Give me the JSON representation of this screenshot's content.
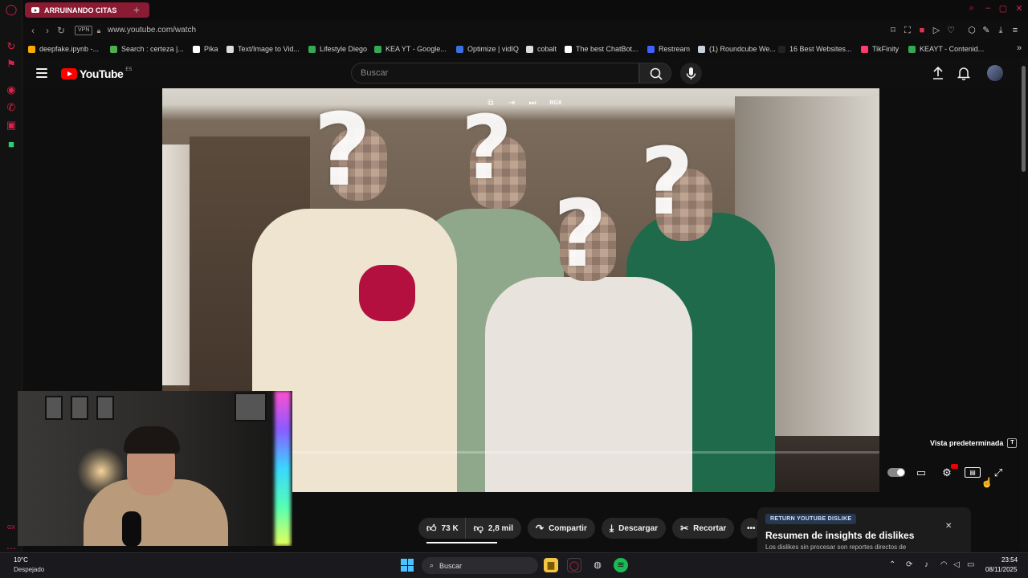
{
  "browser": {
    "tab_title": "ARRUINANDO CITAS",
    "vpn_label": "VPN",
    "url": "www.youtube.com/watch",
    "bookmarks": [
      {
        "label": "deepfake.ipynb -...",
        "color": "#f9ab00"
      },
      {
        "label": "Search : certeza |...",
        "color": "#4caf50"
      },
      {
        "label": "Pika",
        "color": "#ffffff"
      },
      {
        "label": "Text/Image to Vid...",
        "color": "#dddddd"
      },
      {
        "label": "Lifestyle Diego",
        "color": "#34a853"
      },
      {
        "label": "KEA YT - Google...",
        "color": "#34a853"
      },
      {
        "label": "Optimize | vidIQ",
        "color": "#3d6fe0"
      },
      {
        "label": "cobalt",
        "color": "#dddddd"
      },
      {
        "label": "The best ChatBot...",
        "color": "#ffffff"
      },
      {
        "label": "Restream",
        "color": "#3f61ff"
      },
      {
        "label": "(1) Roundcube We...",
        "color": "#c5d3e0"
      },
      {
        "label": "16 Best Websites...",
        "color": "#222222"
      },
      {
        "label": "TikFinity",
        "color": "#ff3b6b"
      },
      {
        "label": "KEAYT - Contenid...",
        "color": "#34a853"
      }
    ]
  },
  "youtube": {
    "logo_text": "YouTube",
    "region": "ES",
    "search_placeholder": "Buscar"
  },
  "player": {
    "overlay_tool_rgx": "RGX",
    "view_label": "Vista predeterminada",
    "view_key": "T",
    "blur_marks": [
      "?",
      "?",
      "?",
      "?"
    ]
  },
  "actions": {
    "likes": "73 K",
    "dislikes": "2,8 mil",
    "share": "Compartir",
    "download": "Descargar",
    "clip": "Recortar"
  },
  "ryd": {
    "tag": "RETURN YOUTUBE DISLIKE",
    "title": "Resumen de insights de dislikes",
    "subtitle": "Los dislikes sin procesar son reportes directos de"
  },
  "taskbar": {
    "temperature": "10°C",
    "weather": "Despejado",
    "search": "Buscar",
    "time": "23:54",
    "date": "08/11/2025"
  },
  "colors": {
    "opera_red": "#d6234a",
    "tab_active": "#8b1a33",
    "yt_red": "#ff0000"
  }
}
